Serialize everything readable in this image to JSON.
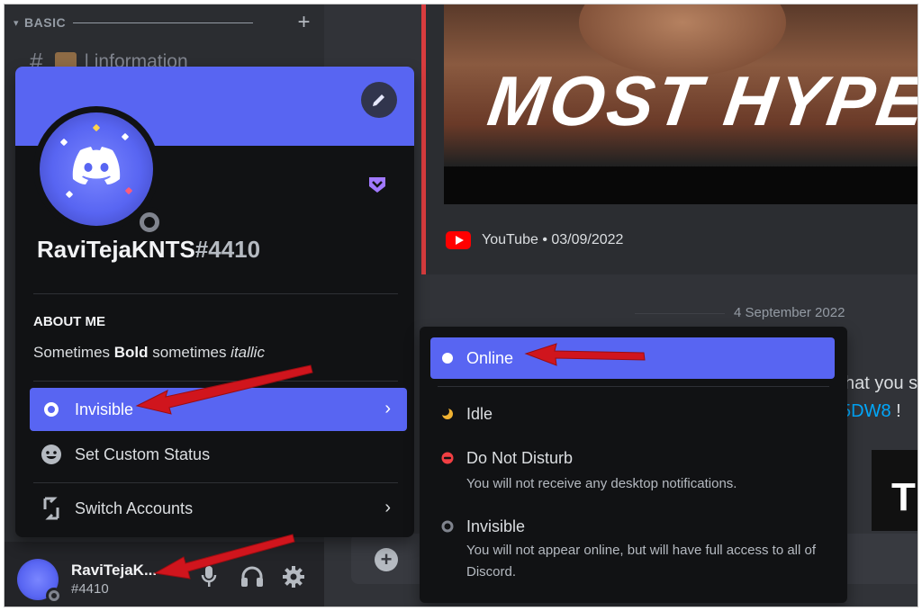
{
  "sidebar": {
    "category_label": "BASIC",
    "channel_name": "| information"
  },
  "chat": {
    "embed_title": "MOST HYPED",
    "embed_provider": "YouTube • 03/09/2022",
    "date_divider": "4 September 2022",
    "partial_text_1": "hat you s",
    "partial_link": "5DW8",
    "partial_link_suffix": " !",
    "partial_embed_letter": "T"
  },
  "profile": {
    "username": "RaviTejaKNTS",
    "discriminator": "#4410",
    "about_heading": "ABOUT ME",
    "about_prefix": "Sometimes ",
    "about_bold": "Bold",
    "about_middle": " sometimes ",
    "about_italic": "itallic",
    "menu": {
      "status_label": "Invisible",
      "custom_status_label": "Set Custom Status",
      "switch_accounts_label": "Switch Accounts"
    }
  },
  "status_menu": {
    "online": {
      "label": "Online"
    },
    "idle": {
      "label": "Idle"
    },
    "dnd": {
      "label": "Do Not Disturb",
      "desc": "You will not receive any desktop notifications."
    },
    "invisible": {
      "label": "Invisible",
      "desc": "You will not appear online, but will have full access to all of Discord."
    }
  },
  "user_panel": {
    "name": "RaviTejaK...",
    "tag": "#4410"
  },
  "colors": {
    "blurple": "#5865f2",
    "annotation_arrow": "#d0151d",
    "youtube_red": "#ff0000",
    "invisible_gray": "#80848e",
    "idle_yellow": "#f0b232",
    "dnd_red": "#f23f43"
  }
}
